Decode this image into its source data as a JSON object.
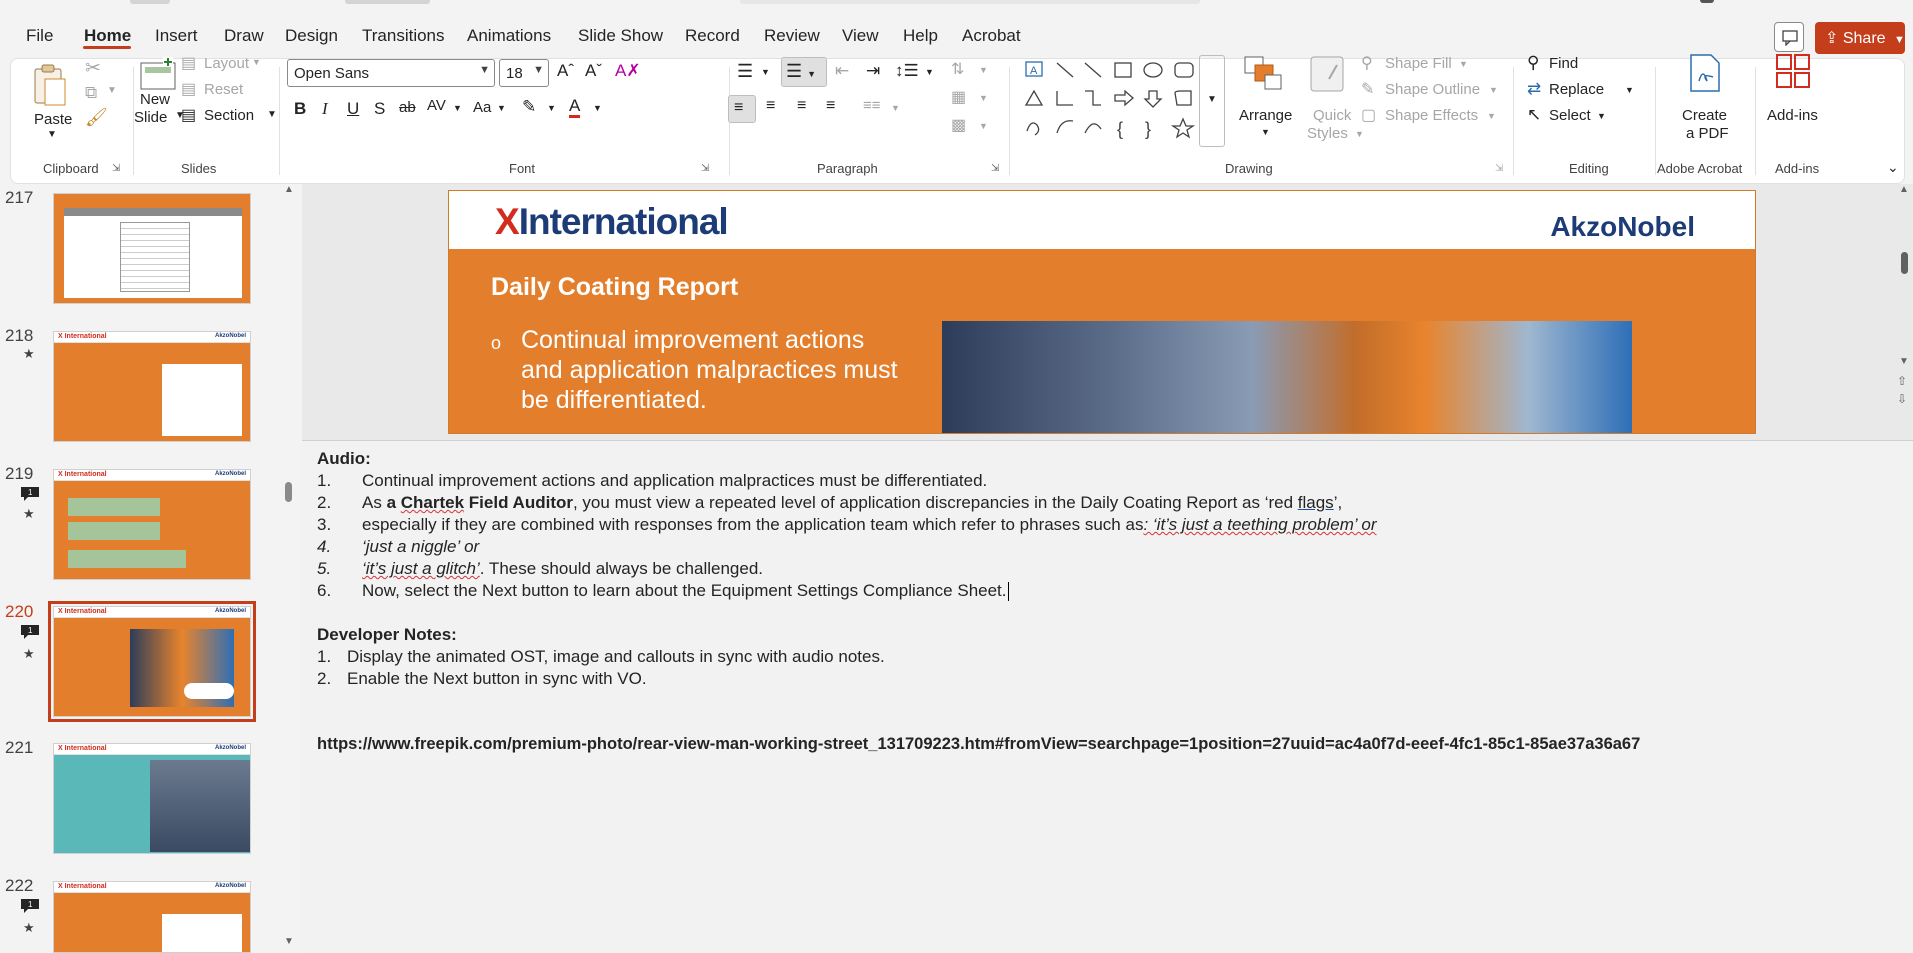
{
  "menu": {
    "tabs": [
      "File",
      "Home",
      "Insert",
      "Draw",
      "Design",
      "Transitions",
      "Animations",
      "Slide Show",
      "Record",
      "Review",
      "View",
      "Help",
      "Acrobat"
    ],
    "active_tab": "Home",
    "share_label": "Share"
  },
  "ribbon": {
    "clipboard": {
      "paste": "Paste",
      "label": "Clipboard"
    },
    "slides": {
      "new_slide_1": "New",
      "new_slide_2": "Slide",
      "layout": "Layout",
      "reset": "Reset",
      "section": "Section",
      "label": "Slides"
    },
    "font": {
      "family": "Open Sans",
      "size": "18",
      "label": "Font"
    },
    "paragraph": {
      "label": "Paragraph"
    },
    "drawing": {
      "arrange": "Arrange",
      "quick_styles_1": "Quick",
      "quick_styles_2": "Styles",
      "shape_fill": "Shape Fill",
      "shape_outline": "Shape Outline",
      "shape_effects": "Shape Effects",
      "label": "Drawing"
    },
    "editing": {
      "find": "Find",
      "replace": "Replace",
      "select": "Select",
      "label": "Editing"
    },
    "acrobat": {
      "create_pdf_1": "Create",
      "create_pdf_2": "a PDF",
      "label": "Adobe Acrobat"
    },
    "addins": {
      "button": "Add-ins",
      "label": "Add-ins"
    }
  },
  "slides_panel": [
    {
      "num": "217",
      "comments": "",
      "starred": false,
      "selected": false,
      "theme": "orange-white"
    },
    {
      "num": "218",
      "comments": "",
      "starred": true,
      "selected": false,
      "theme": "orange"
    },
    {
      "num": "219",
      "comments": "1",
      "starred": true,
      "selected": false,
      "theme": "orange-green"
    },
    {
      "num": "220",
      "comments": "1",
      "starred": true,
      "selected": true,
      "theme": "orange-photo"
    },
    {
      "num": "221",
      "comments": "",
      "starred": false,
      "selected": false,
      "theme": "teal"
    },
    {
      "num": "222",
      "comments": "1",
      "starred": true,
      "selected": false,
      "theme": "orange-table"
    }
  ],
  "thumb_brand": {
    "left": "X International",
    "right": "AkzoNobel"
  },
  "slide": {
    "logo_left_x": "X",
    "logo_left_text": "International",
    "logo_right": "AkzoNobel",
    "title": "Daily Coating Report",
    "bullet_mark": "o",
    "bullet": "Continual improvement actions and application malpractices must be differentiated."
  },
  "notes": {
    "audio_heading": "Audio:",
    "audio_items": [
      {
        "n": "1.",
        "text": "Continual improvement actions and application malpractices must be differentiated."
      },
      {
        "n": "2.",
        "pre": "As ",
        "bold_a": "a ",
        "bold_b": "Chartek",
        "bold_c": " Field Auditor",
        "mid": ", you must view a repeated level of application discrepancies in the Daily Coating Report as ‘red ",
        "link": "flags",
        "post": "’,"
      },
      {
        "n": "3.",
        "pre": "especially if they are combined with responses from the application team which refer to phrases such as",
        "italic": ": ‘it’s just a teething problem’ or"
      },
      {
        "n": "4.",
        "italic": "‘just a niggle’ or"
      },
      {
        "n": "5.",
        "italic": "‘it’s just a glitch’",
        "post": ". These should always be challenged."
      },
      {
        "n": "6.",
        "text": "Now, select the Next button to learn about the Equipment Settings Compliance Sheet."
      }
    ],
    "dev_heading": "Developer Notes:",
    "dev_items": [
      {
        "n": "1.",
        "text": "Display the animated OST, image and callouts in sync with audio notes."
      },
      {
        "n": "2.",
        "text": "Enable the Next button in sync with VO."
      }
    ],
    "url": "https://www.freepik.com/premium-photo/rear-view-man-working-street_131709223.htm#fromView=searchpage=1position=27uuid=ac4a0f7d-eeef-4fc1-85c1-85ae37a36a67"
  },
  "colors": {
    "accent": "#c43e1c",
    "slide_orange": "#e37f2c",
    "brand_blue": "#1d3c77",
    "brand_red": "#d12c1f"
  }
}
